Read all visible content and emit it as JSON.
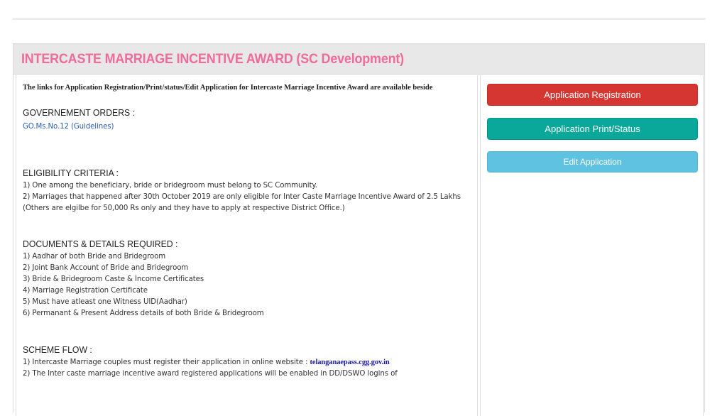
{
  "header": {
    "title": "INTERCASTE MARRIAGE INCENTIVE AWARD (SC Development)"
  },
  "intro": "The links for Application Registration/Print/status/Edit Application for Intercaste Marriage Incentive Award are available beside",
  "government_orders": {
    "heading": "GOVERNEMENT ORDERS :",
    "link": "GO.Ms.No.12 (Guidelines)"
  },
  "eligibility": {
    "heading": "ELIGIBILITY CRITERIA :",
    "lines": [
      "1) One among the beneficiary, bride or bridegroom must belong to SC Community.",
      "2) Marriages that happened after 30th October 2019 are only eligible for Inter Caste Marriage Incentive Award of 2.5 Lakhs",
      "(Others are elgilbe for 50,000 Rs only and they have to apply at respective District Office.)"
    ]
  },
  "documents": {
    "heading": "DOCUMENTS & DETAILS REQUIRED :",
    "lines": [
      "1) Aadhar of both Bride and Bridegroom",
      "2) Joint Bank Account of Bride and Bridegroom",
      "3) Bride & Bridegroom Caste & Income Certificates",
      "4) Marriage Registration Certificate",
      "5) Must have atleast one Witness UID(Aadhar)",
      "6) Permanant & Present Address details of both Bride & Bridegroom"
    ]
  },
  "scheme_flow": {
    "heading": "SCHEME FLOW :",
    "line1_prefix": "1) Intercaste Marriage couples must register their application in online website : ",
    "line1_link": "telanganaepass.cgg.gov.in",
    "line2": "2) The Inter caste marriage incentive award registered applications will be enabled in DD/DSWO logins of"
  },
  "buttons": {
    "registration": "Application Registration",
    "print_status": "Application Print/Status",
    "edit": "Edit Application"
  },
  "colors": {
    "title_pink": "#ef6b9a",
    "btn_red": "#d63632",
    "btn_teal": "#0aa89a",
    "btn_blue": "#5ec2e0"
  }
}
